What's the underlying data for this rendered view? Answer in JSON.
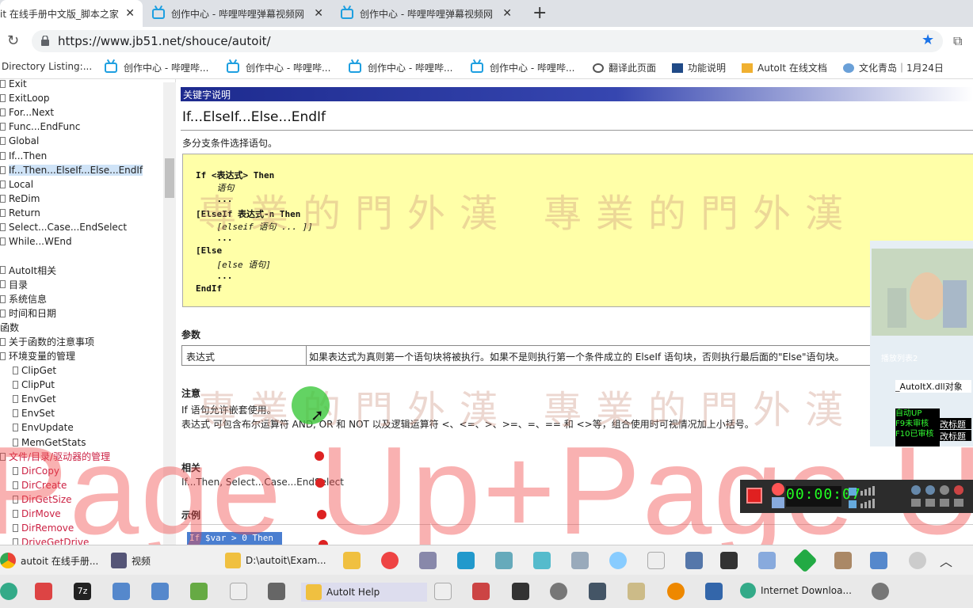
{
  "browser": {
    "tabs": [
      {
        "title": "it 在线手册中文版_脚本之家"
      },
      {
        "title": "创作中心 - 哔哩哔哩弹幕视频网"
      },
      {
        "title": "创作中心 - 哔哩哔哩弹幕视频网"
      }
    ],
    "new_tab_label": "+",
    "url": "https://www.jb51.net/shouce/autoit/",
    "bookmarks": [
      "Directory Listing:...",
      "创作中心 - 哔哩哔...",
      "创作中心 - 哔哩哔...",
      "创作中心 - 哔哩哔...",
      "创作中心 - 哔哩哔...",
      "翻译此页面",
      "功能说明",
      "AutoIt 在线文档",
      "文化青岛｜1月24日"
    ]
  },
  "tree": {
    "items": [
      "Exit",
      "ExitLoop",
      "For...Next",
      "Func...EndFunc",
      "Global",
      "If...Then",
      "If...Then...ElseIf...Else...EndIf",
      "Local",
      "ReDim",
      "Return",
      "Select...Case...EndSelect",
      "While...WEnd",
      "",
      "AutoIt相关",
      "目录",
      "系统信息",
      "时间和日期",
      "函数",
      "关于函数的注意事项",
      "环境变量的管理",
      "ClipGet",
      "ClipPut",
      "EnvGet",
      "EnvSet",
      "EnvUpdate",
      "MemGetStats",
      "文件/目录/驱动器的管理",
      "DirCopy",
      "DirCreate",
      "DirGetSize",
      "DirMove",
      "DirRemove",
      "DriveGetDrive"
    ],
    "selected": "If...Then...ElseIf...Else...EndIf"
  },
  "content": {
    "section_bar": "关键字说明",
    "title": "If...ElseIf...Else...EndIf",
    "description": "多分支条件选择语句。",
    "syntax_lines": [
      "If <表达式> Then",
      "    语句",
      "    ...",
      "[ElseIf 表达式-n Then",
      "    [elseif 语句 ... ]]",
      "    ...",
      "[Else",
      "    [else 语句]",
      "    ...",
      "EndIf"
    ],
    "params_heading": "参数",
    "param_name": "表达式",
    "param_desc": "如果表达式为真则第一个语句块将被执行。如果不是则执行第一个条件成立的 ElseIf 语句块，否则执行最后面的\"Else\"语句块。",
    "notes_heading": "注意",
    "note_1": "If 语句允许嵌套使用。",
    "note_2": "表达式 可包含布尔运算符 AND, OR 和 NOT 以及逻辑运算符 <、<=、>、>=、=、== 和 <>等，组合使用时可视情况加上小括号。",
    "related_heading": "相关",
    "related": "If...Then, Select...Case...EndSelect",
    "example_heading": "示例",
    "example_code": "If $var > 0 Then"
  },
  "overlay": {
    "watermark": "專業的門外漢",
    "key_hint": "Page Up+Page Up",
    "side_text_1": "_AutoItX.dll对象",
    "side_text_2": "自动UP",
    "side_text_3": "F9未审核",
    "side_text_4": "F10已审核",
    "side_btn_1": "改标题",
    "side_btn_2": "改标题",
    "side_text_5": "播放列表2",
    "rec_timer": "00:00:07"
  },
  "taskbar1": [
    {
      "label": "autoit 在线手册..."
    },
    {
      "label": "视频"
    },
    {
      "label": "D:\\autoit\\Exam..."
    }
  ],
  "taskbar2": [
    {
      "label": "AutoIt Help"
    },
    {
      "label": "Internet Downloa..."
    }
  ]
}
